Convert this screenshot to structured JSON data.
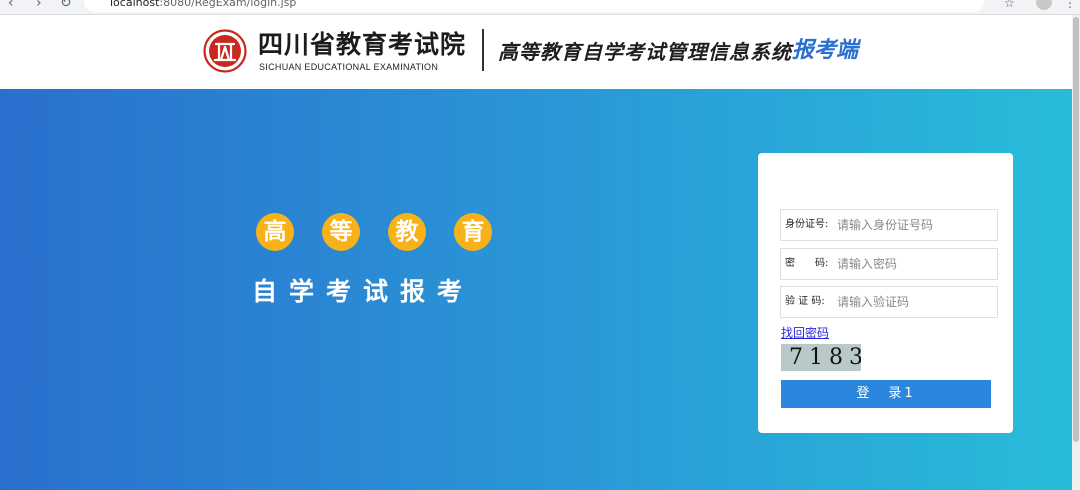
{
  "browser": {
    "url_host": "localhost",
    "url_path": ":8080/RegExam/login.jsp",
    "back_icon": "back-arrow-icon",
    "forward_icon": "forward-arrow-icon",
    "reload_icon": "reload-icon"
  },
  "header": {
    "logo_icon": "seal-logo-icon",
    "org_name": "四川省教育考试院",
    "org_name_en": "SICHUAN EDUCATIONAL EXAMINATION",
    "system_name": "高等教育自学考试管理信息系统",
    "client_tag": "报考端",
    "client_tag_color": "#2b6fd0"
  },
  "hero": {
    "title_chars": [
      "高",
      "等",
      "教",
      "育"
    ],
    "subtitle": "自学考试报考",
    "title_badge_color": "#f7b21a",
    "gradient_start": "#2a6fce",
    "gradient_end": "#28bcd9"
  },
  "login": {
    "id_label": "身份证号:",
    "id_placeholder": "请输入身份证号码",
    "password_label": "密　　码:",
    "password_placeholder": "请输入密码",
    "captcha_label": "验 证 码:",
    "captcha_placeholder": "请输入验证码",
    "forgot_link": "找回密码",
    "captcha_text": "7183",
    "login_button": "登　录1",
    "button_color": "#2b86dd"
  }
}
